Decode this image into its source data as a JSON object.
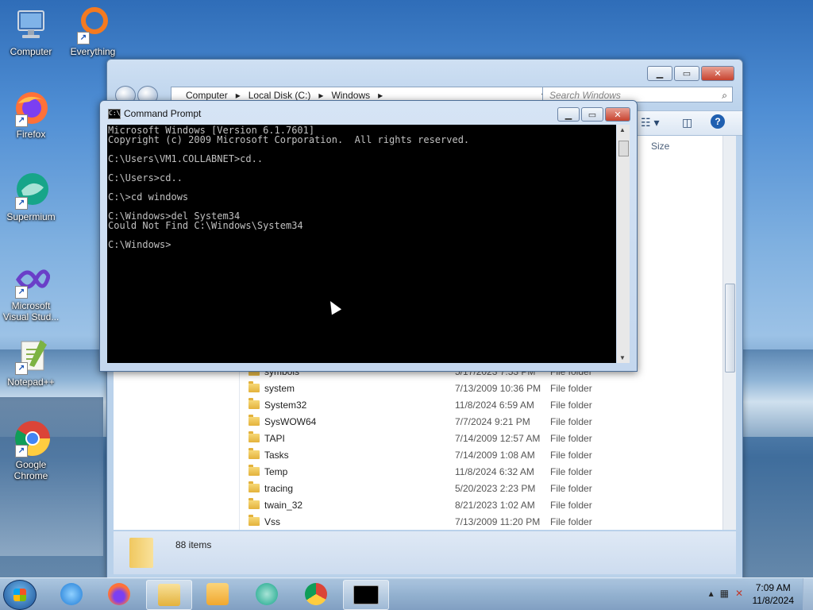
{
  "desktop": {
    "icons": [
      {
        "label": "Computer"
      },
      {
        "label": "Everything"
      },
      {
        "label": "Firefox"
      },
      {
        "label": "Supermium"
      },
      {
        "label": "Microsoft Visual Stud..."
      },
      {
        "label": "Notepad++"
      },
      {
        "label": "Google Chrome"
      }
    ]
  },
  "explorer": {
    "breadcrumb": [
      "Computer",
      "Local Disk (C:)",
      "Windows"
    ],
    "search_placeholder": "Search Windows",
    "column_size": "Size",
    "files": [
      {
        "name": "symbols",
        "date": "5/17/2023 7:53 PM",
        "type": "File folder"
      },
      {
        "name": "system",
        "date": "7/13/2009 10:36 PM",
        "type": "File folder"
      },
      {
        "name": "System32",
        "date": "11/8/2024 6:59 AM",
        "type": "File folder"
      },
      {
        "name": "SysWOW64",
        "date": "7/7/2024 9:21 PM",
        "type": "File folder"
      },
      {
        "name": "TAPI",
        "date": "7/14/2009 12:57 AM",
        "type": "File folder"
      },
      {
        "name": "Tasks",
        "date": "7/14/2009 1:08 AM",
        "type": "File folder"
      },
      {
        "name": "Temp",
        "date": "11/8/2024 6:32 AM",
        "type": "File folder"
      },
      {
        "name": "tracing",
        "date": "5/20/2023 2:23 PM",
        "type": "File folder"
      },
      {
        "name": "twain_32",
        "date": "8/21/2023 1:02 AM",
        "type": "File folder"
      },
      {
        "name": "Vss",
        "date": "7/13/2009 11:20 PM",
        "type": "File folder"
      }
    ],
    "status_items": "88 items"
  },
  "cmd": {
    "title": "Command Prompt",
    "icon_text": "C:\\_",
    "lines": [
      "Microsoft Windows [Version 6.1.7601]",
      "Copyright (c) 2009 Microsoft Corporation.  All rights reserved.",
      "",
      "C:\\Users\\VM1.COLLABNET>cd..",
      "",
      "C:\\Users>cd..",
      "",
      "C:\\>cd windows",
      "",
      "C:\\Windows>del System34",
      "Could Not Find C:\\Windows\\System34",
      "",
      "C:\\Windows>"
    ]
  },
  "taskbar": {
    "clock_time": "7:09 AM",
    "clock_date": "11/8/2024"
  },
  "colors": {
    "accent": "#1f5fb0",
    "console_bg": "#000000",
    "console_fg": "#c0c0c0"
  }
}
